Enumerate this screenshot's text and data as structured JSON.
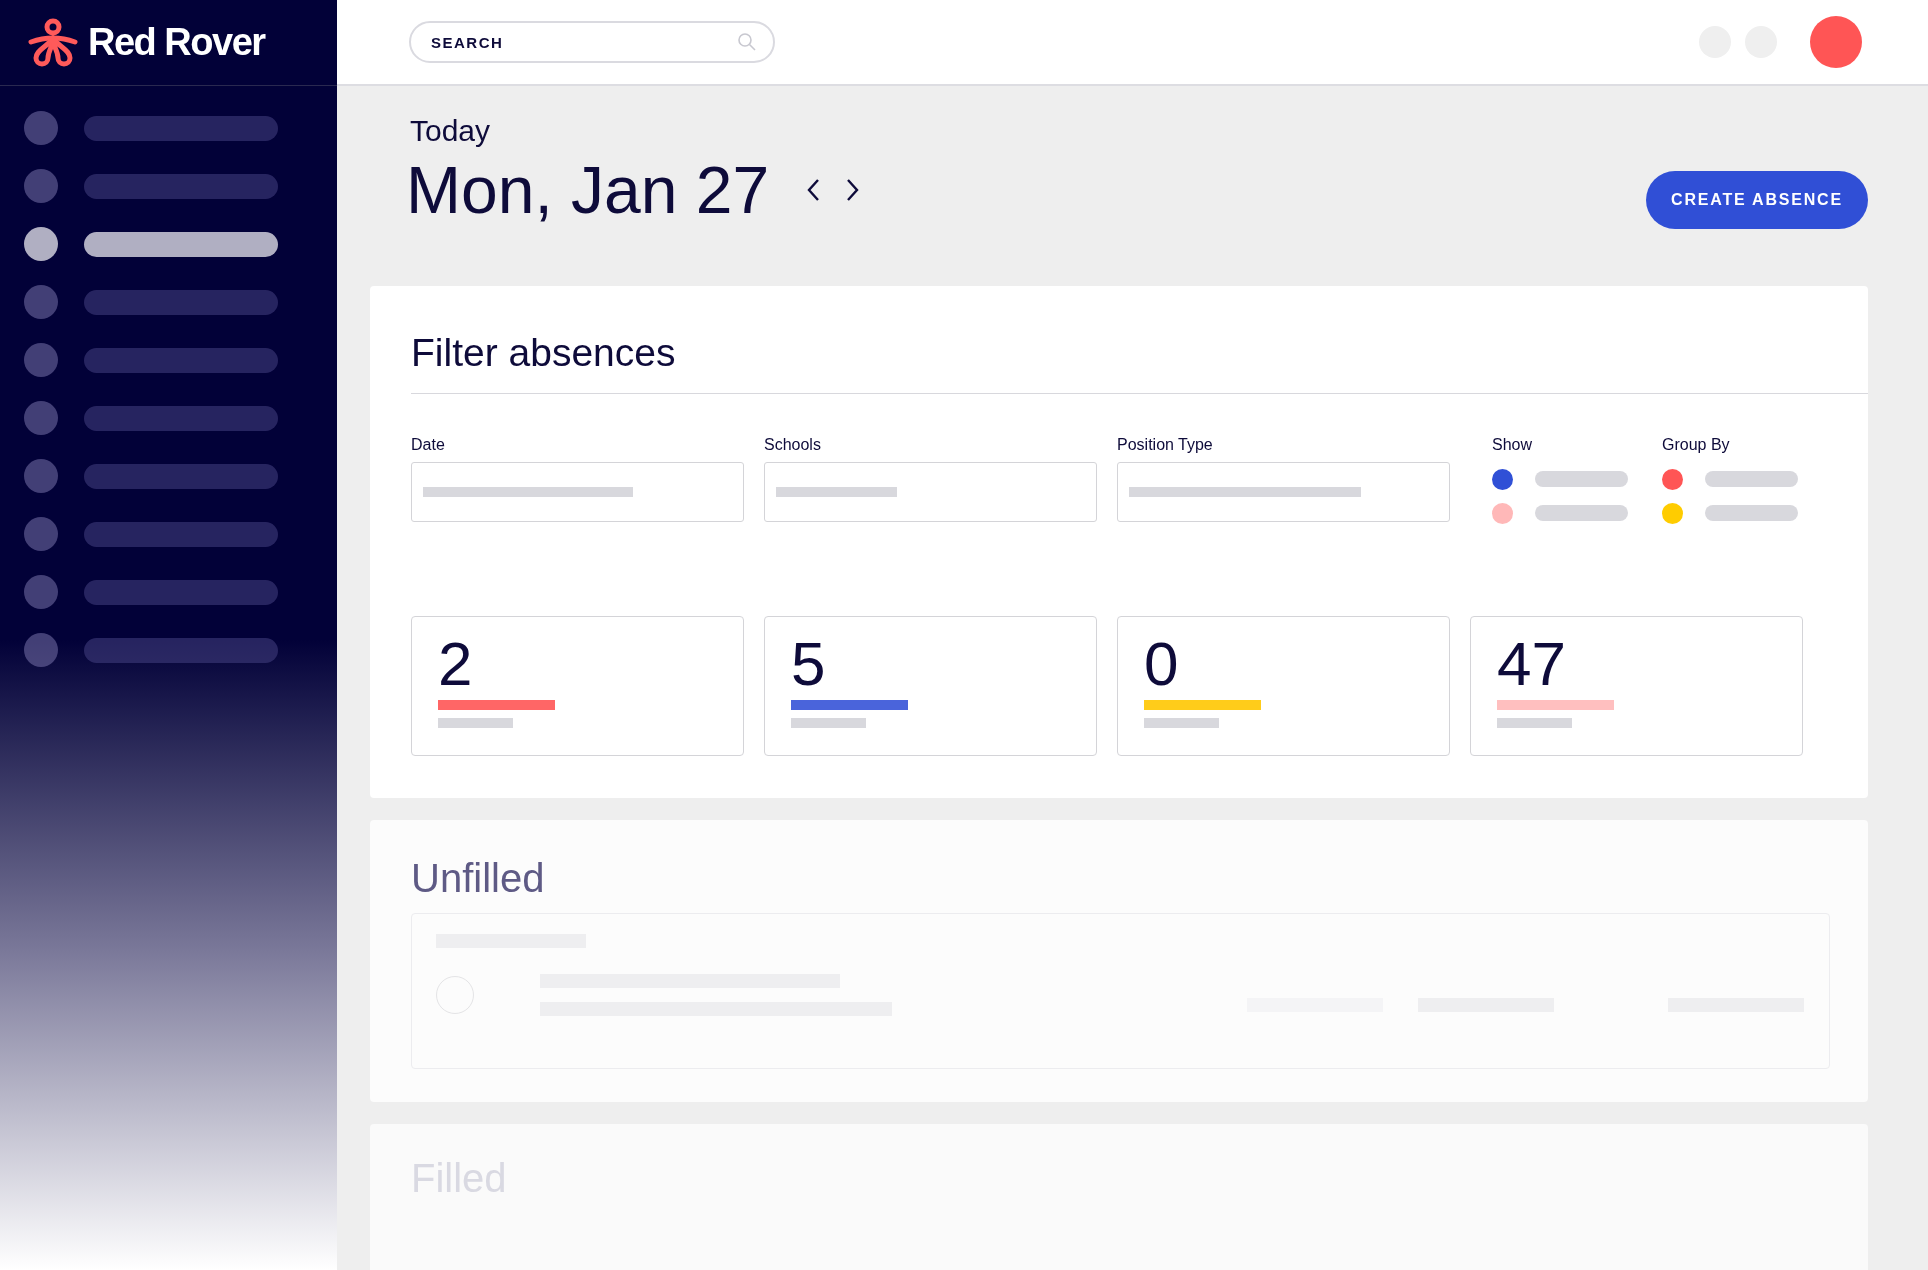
{
  "brand": {
    "name": "Red Rover"
  },
  "sidebar": {
    "items": [
      {
        "selected": false
      },
      {
        "selected": false
      },
      {
        "selected": true
      },
      {
        "selected": false
      },
      {
        "selected": false
      },
      {
        "selected": false
      },
      {
        "selected": false
      },
      {
        "selected": false
      },
      {
        "selected": false
      },
      {
        "selected": false
      }
    ]
  },
  "header": {
    "search": {
      "placeholder": "SEARCH"
    }
  },
  "page": {
    "eyebrow": "Today",
    "date": "Mon, Jan 27",
    "primary_button": "CREATE ABSENCE"
  },
  "filters": {
    "title": "Filter absences",
    "fields": [
      {
        "label": "Date"
      },
      {
        "label": "Schools"
      },
      {
        "label": "Position Type"
      }
    ],
    "option_groups": [
      {
        "label": "Show",
        "options": [
          {
            "color": "#3050d6"
          },
          {
            "color": "#ffb8b8"
          }
        ]
      },
      {
        "label": "Group By",
        "options": [
          {
            "color": "#ff5555"
          },
          {
            "color": "#ffcc00"
          }
        ]
      }
    ],
    "stats": [
      {
        "value": "2",
        "color": "#ff6666"
      },
      {
        "value": "5",
        "color": "#4a64db"
      },
      {
        "value": "0",
        "color": "#ffcc1a"
      },
      {
        "value": "47",
        "color": "#ffbfbf"
      }
    ]
  },
  "sections": [
    {
      "title": "Unfilled",
      "kind": "list"
    },
    {
      "title": "Filled",
      "kind": "faded"
    }
  ]
}
